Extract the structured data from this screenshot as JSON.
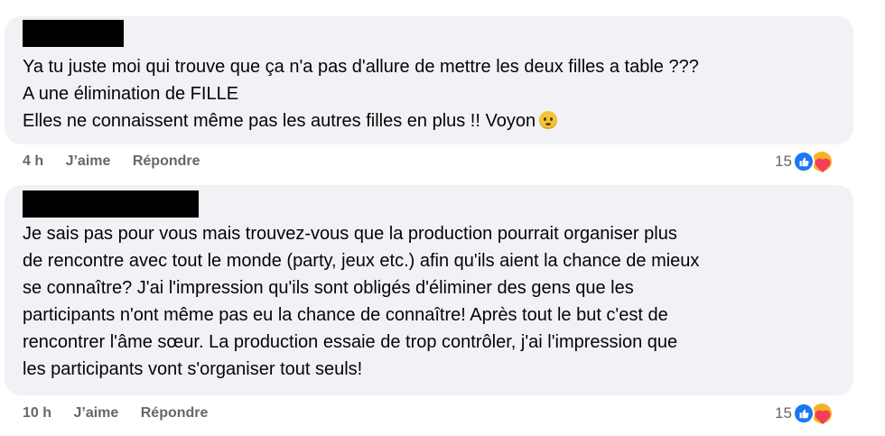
{
  "comments": [
    {
      "text_lines": [
        "Ya tu juste moi qui trouve que ça n'a pas d'allure de mettre les deux filles a table ???",
        "A une élimination de FILLE",
        "Elles ne connaissent même pas les autres filles en plus !! Voyon"
      ],
      "emoji_icon": "flushed-face-icon",
      "time": "4 h",
      "like_label": "J’aime",
      "reply_label": "Répondre",
      "reaction_count": "15",
      "reaction_icons": [
        "like-icon",
        "care-icon"
      ]
    },
    {
      "text_lines": [
        "Je sais pas pour vous mais trouvez-vous que la production pourrait organiser plus",
        "de rencontre avec tout le monde (party, jeux etc.) afin qu'ils aient la chance de mieux",
        "se connaître? J'ai l'impression qu'ils sont obligés d'éliminer des gens que les",
        "participants n'ont même pas eu la chance de connaître! Après tout le but c'est de",
        "rencontrer l'âme sœur. La production essaie de trop contrôler, j'ai l'impression que",
        "les participants vont s'organiser tout seuls!"
      ],
      "time": "10 h",
      "like_label": "J’aime",
      "reply_label": "Répondre",
      "reaction_count": "15",
      "reaction_icons": [
        "like-icon",
        "care-icon"
      ]
    }
  ],
  "colors": {
    "bubble": "#f0f2f5",
    "meta_text": "#65676b",
    "like_blue": "#1877f2",
    "care_yellow": "#f7b125",
    "heart_red": "#f33e58"
  }
}
